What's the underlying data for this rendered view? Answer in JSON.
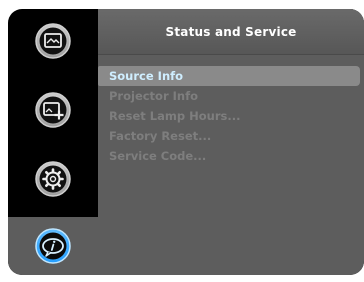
{
  "panel": {
    "title": "Status and Service"
  },
  "menu": {
    "items": [
      {
        "label": "Source Info",
        "selected": true
      },
      {
        "label": "Projector Info",
        "selected": false
      },
      {
        "label": "Reset Lamp Hours...",
        "selected": false
      },
      {
        "label": "Factory Reset...",
        "selected": false
      },
      {
        "label": "Service Code...",
        "selected": false
      }
    ]
  },
  "sidebar": {
    "tabs": [
      {
        "icon": "picture-icon",
        "active": false
      },
      {
        "icon": "picture-plus-icon",
        "active": false
      },
      {
        "icon": "gear-icon",
        "active": false
      },
      {
        "icon": "info-icon",
        "active": true
      }
    ]
  },
  "colors": {
    "osd_background": "#000000",
    "panel": "#5d5d5d",
    "selected_row": "#8a8a8a",
    "selected_text": "#cfeeff",
    "dimmed_text": "#7e7e7e",
    "active_icon_ring": "#1e9bff"
  }
}
